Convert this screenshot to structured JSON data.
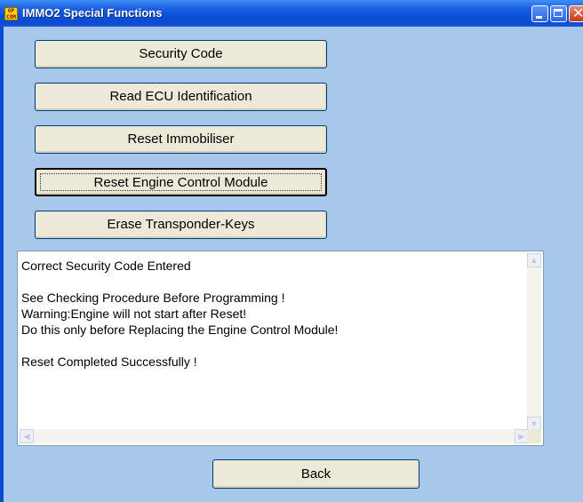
{
  "window": {
    "title": "IMMO2 Special Functions",
    "app_icon_text": "OP\nCOM",
    "controls": {
      "minimize": "minimize",
      "maximize": "maximize",
      "close": "✕"
    }
  },
  "functions": [
    {
      "label": "Security Code",
      "focused": false
    },
    {
      "label": "Read ECU Identification",
      "focused": false
    },
    {
      "label": "Reset Immobiliser",
      "focused": false
    },
    {
      "label": "Reset Engine Control Module",
      "focused": true
    },
    {
      "label": "Erase Transponder-Keys",
      "focused": false
    }
  ],
  "output": {
    "text": "Correct Security Code Entered\n\nSee Checking Procedure Before Programming !\nWarning:Engine will not start after Reset!\nDo this only before Replacing the Engine Control Module!\n\nReset Completed Successfully !"
  },
  "footer": {
    "back_label": "Back"
  },
  "colors": {
    "window_bg": "#a7c8ea",
    "titlebar": "#0b4bd0",
    "button_face": "#ece9d8"
  }
}
